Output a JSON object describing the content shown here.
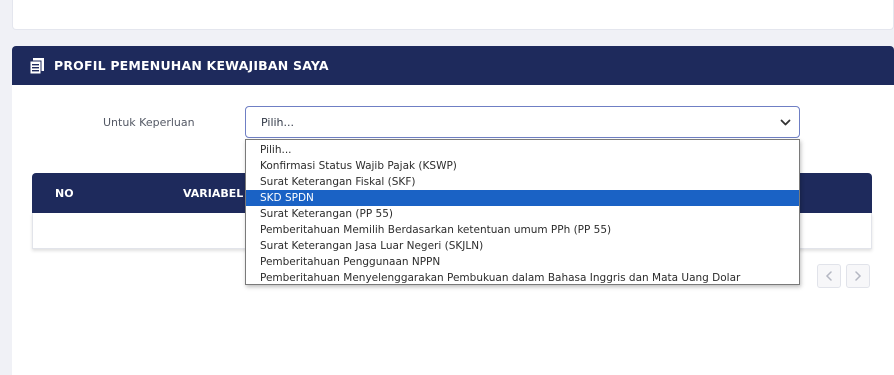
{
  "panel": {
    "title": "PROFIL PEMENUHAN KEWAJIBAN SAYA"
  },
  "form": {
    "label": "Untuk Keperluan",
    "selected_value": "Pilih..."
  },
  "table": {
    "columns": [
      "NO",
      "VARIABEL"
    ]
  },
  "dropdown": {
    "options": [
      "Pilih...",
      "Konfirmasi Status Wajib Pajak (KSWP)",
      "Surat Keterangan Fiskal (SKF)",
      "SKD SPDN",
      "Surat Keterangan (PP 55)",
      "Pemberitahuan Memilih Berdasarkan ketentuan umum PPh (PP 55)",
      "Surat Keterangan Jasa Luar Negeri (SKJLN)",
      "Pemberitahuan Penggunaan NPPN",
      "Pemberitahuan Menyelenggarakan Pembukuan dalam Bahasa Inggris dan Mata Uang Dolar"
    ],
    "highlighted_index": 3
  },
  "icons": {
    "panel": "document-list-icon",
    "select": "chevron-down-icon",
    "prev": "chevron-left-icon",
    "next": "chevron-right-icon"
  },
  "colors": {
    "header_navy": "#1e2a5c",
    "highlight_blue": "#1a62c5",
    "page_bg": "#f0f1f6"
  }
}
